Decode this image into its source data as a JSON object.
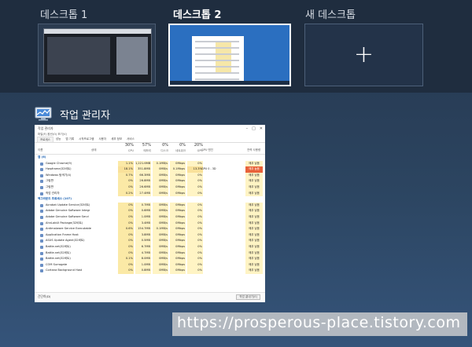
{
  "desktops": [
    {
      "label": "데스크톱 1"
    },
    {
      "label": "데스크톱 2"
    },
    {
      "label": "새 데스크톱",
      "icon": "plus-icon"
    }
  ],
  "app": {
    "title": "작업 관리자",
    "icon": "task-manager-icon"
  },
  "task_manager": {
    "window_title": "작업 관리자",
    "menu": "파일(F)   옵션(O)   보기(V)",
    "tabs": [
      "프로세스",
      "성능",
      "앱 기록",
      "시작프로그램",
      "사용자",
      "세부 정보",
      "서비스"
    ],
    "columns": {
      "name": "이름",
      "status": "상태",
      "cpu": {
        "pct": "30%",
        "label": "CPU"
      },
      "memory": {
        "pct": "57%",
        "label": "메모리"
      },
      "disk": {
        "pct": "0%",
        "label": "디스크"
      },
      "network": {
        "pct": "0%",
        "label": "네트워크"
      },
      "gpu": {
        "pct": "20%",
        "label": "GPU"
      },
      "gpu_engine": "GPU 엔진",
      "power": "전력 사용량"
    },
    "rows": [
      {
        "group": true,
        "name": "앱 (6)"
      },
      {
        "name": "Google Chrome(9)",
        "cpu": "1.1%",
        "mem": "1,221.6MB",
        "disk": "0.1MB/s",
        "net": "0Mbps",
        "gpu": "0%",
        "power": "매우 낮음"
      },
      {
        "name": "Hwpframe(32비트)",
        "cpu": "18.1%",
        "mem": "351.8MB",
        "disk": "0MB/s",
        "net": "0.1Mbps",
        "gpu": "13.3%",
        "engine": "GPU 0 - 3D",
        "power": "매우 높음",
        "power_level": "hot"
      },
      {
        "name": "Windows 탐색기(4)",
        "cpu": "0.7%",
        "mem": "66.3MB",
        "disk": "0MB/s",
        "net": "0Mbps",
        "gpu": "0%",
        "power": "매우 낮음"
      },
      {
        "name": "그림판",
        "cpu": "0%",
        "mem": "26.8MB",
        "disk": "0MB/s",
        "net": "0Mbps",
        "gpu": "0%",
        "power": "매우 낮음"
      },
      {
        "name": "그림판",
        "cpu": "0%",
        "mem": "26.6MB",
        "disk": "0MB/s",
        "net": "0Mbps",
        "gpu": "0%",
        "power": "매우 낮음"
      },
      {
        "name": "작업 관리자",
        "cpu": "0.2%",
        "mem": "27.4MB",
        "disk": "0MB/s",
        "net": "0Mbps",
        "gpu": "0%",
        "power": "매우 낮음"
      },
      {
        "group": true,
        "name": "백그라운드 프로세스 (107)"
      },
      {
        "name": "Acrobat Update Service(32비트)",
        "cpu": "0%",
        "mem": "0.7MB",
        "disk": "0MB/s",
        "net": "0Mbps",
        "gpu": "0%",
        "power": "매우 낮음"
      },
      {
        "name": "Adobe Genuine Software Integr",
        "cpu": "0%",
        "mem": "0.6MB",
        "disk": "0MB/s",
        "net": "0Mbps",
        "gpu": "0%",
        "power": "매우 낮음"
      },
      {
        "name": "Adobe Genuine Software Servi",
        "cpu": "0%",
        "mem": "1.0MB",
        "disk": "0MB/s",
        "net": "0Mbps",
        "gpu": "0%",
        "power": "매우 낮음"
      },
      {
        "name": "AhnLabUI Package(32비트)",
        "cpu": "0%",
        "mem": "3.4MB",
        "disk": "0MB/s",
        "net": "0Mbps",
        "gpu": "0%",
        "power": "매우 낮음"
      },
      {
        "name": "Antimalware Service Executable",
        "cpu": "0.6%",
        "mem": "154.7MB",
        "disk": "0.1MB/s",
        "net": "0Mbps",
        "gpu": "0%",
        "power": "매우 낮음"
      },
      {
        "name": "Application Frame Host",
        "cpu": "0%",
        "mem": "3.8MB",
        "disk": "0MB/s",
        "net": "0Mbps",
        "gpu": "0%",
        "power": "매우 낮음"
      },
      {
        "name": "ASUS Update Agent(32비트)",
        "cpu": "0%",
        "mem": "0.5MB",
        "disk": "0MB/s",
        "net": "0Mbps",
        "gpu": "0%",
        "power": "매우 낮음"
      },
      {
        "name": "Battle.net(32비트)",
        "cpu": "0%",
        "mem": "6.7MB",
        "disk": "0MB/s",
        "net": "0Mbps",
        "gpu": "0%",
        "power": "매우 낮음"
      },
      {
        "name": "Battle.net(32비트)",
        "cpu": "0%",
        "mem": "4.7MB",
        "disk": "0MB/s",
        "net": "0Mbps",
        "gpu": "0%",
        "power": "매우 낮음"
      },
      {
        "name": "Battle.net(32비트)",
        "cpu": "0.1%",
        "mem": "8.0MB",
        "disk": "0MB/s",
        "net": "0Mbps",
        "gpu": "0%",
        "power": "매우 낮음"
      },
      {
        "name": "COM Surrogate",
        "cpu": "0%",
        "mem": "1.0MB",
        "disk": "0MB/s",
        "net": "0Mbps",
        "gpu": "0%",
        "power": "매우 낮음"
      },
      {
        "name": "Cortana Background Host",
        "cpu": "0%",
        "mem": "0.8MB",
        "disk": "0MB/s",
        "net": "0Mbps",
        "gpu": "0%",
        "power": "매우 낮음"
      }
    ],
    "footer": {
      "less": "간단히(D)",
      "end_task": "작업 끝내기(E)"
    }
  },
  "watermark": "https://prosperous-place.tistory.com"
}
